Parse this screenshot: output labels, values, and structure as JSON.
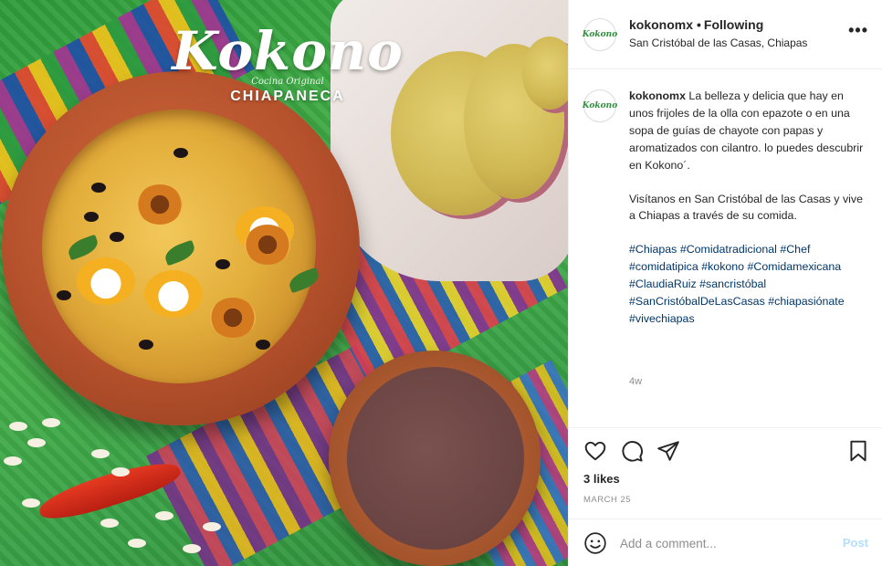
{
  "photo": {
    "logo_script": "Kokono",
    "logo_tagline": "Cocina Original",
    "logo_region": "CHIAPANECA"
  },
  "header": {
    "avatar_text": "Kokono",
    "username": "kokonomx",
    "follow_dot": "•",
    "follow_status": "Following",
    "location": "San Cristóbal de las Casas, Chiapas",
    "more_icon": "more-horizontal-icon"
  },
  "caption": {
    "avatar_text": "Kokono",
    "username": "kokonomx",
    "paragraph1": "La belleza y delicia que hay en unos frijoles de la olla con epazote o en una sopa de guías de chayote con papas y aromatizados con cilantro. lo puedes descubrir en Kokono´.",
    "paragraph2": "Visítanos en San Cristóbal de las Casas y vive a Chiapas a través de su comida.",
    "hashtags": [
      "#Chiapas",
      "#Comidatradicional",
      "#Chef",
      "#comidatipica",
      "#kokono",
      "#Comidamexicana",
      "#ClaudiaRuiz",
      "#sancristóbal",
      "#SanCristóbalDeLasCasas",
      "#chiapasiónate",
      "#vivechiapas"
    ],
    "time_ago": "4w"
  },
  "actions": {
    "icons": [
      "heart-icon",
      "comment-icon",
      "share-icon",
      "bookmark-icon"
    ],
    "likes": "3 likes",
    "date": "MARCH 25"
  },
  "comment": {
    "placeholder": "Add a comment...",
    "post_label": "Post"
  },
  "colors": {
    "link": "#00376b",
    "muted": "#8e8e8e",
    "post_disabled": "#b2dffc",
    "border": "#efefef"
  }
}
